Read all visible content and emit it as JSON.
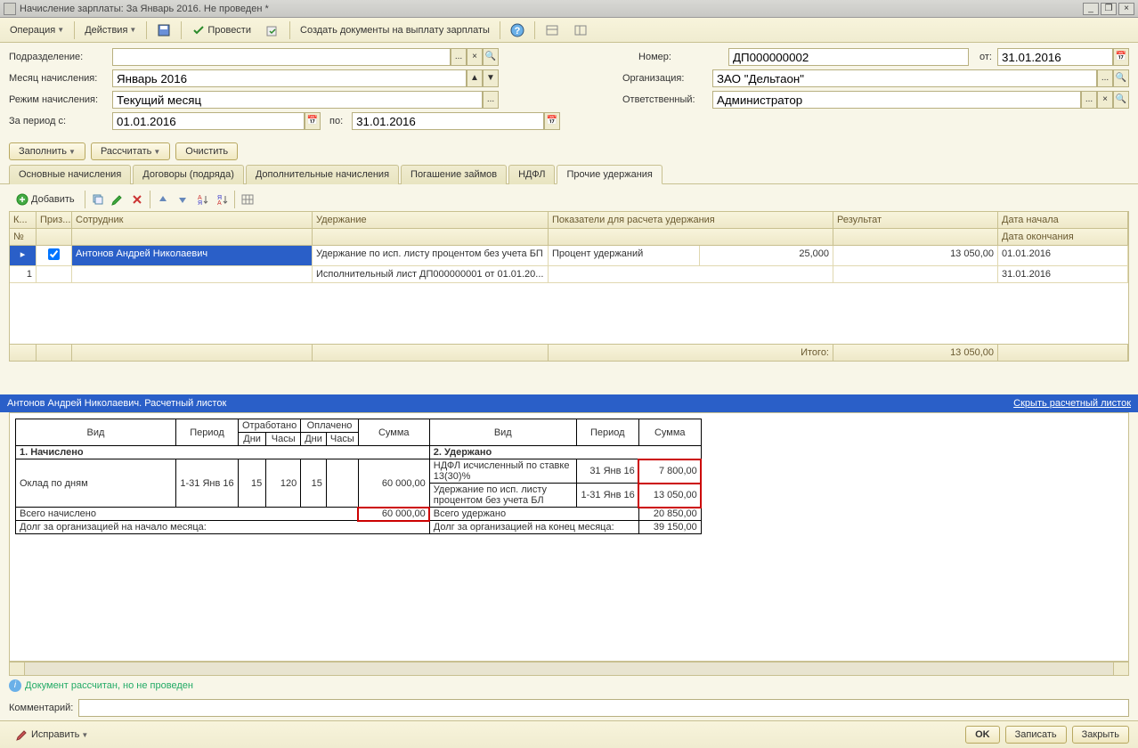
{
  "window": {
    "title": "Начисление зарплаты: За Январь 2016. Не проведен *"
  },
  "toolbar": {
    "operation": "Операция",
    "actions": "Действия",
    "post": "Провести",
    "create_docs": "Создать документы на выплату зарплаты"
  },
  "form": {
    "subdivision_label": "Подразделение:",
    "subdivision": "",
    "number_label": "Номер:",
    "number": "ДП000000002",
    "date_label": "от:",
    "date": "31.01.2016",
    "month_label": "Месяц начисления:",
    "month": "Январь 2016",
    "org_label": "Организация:",
    "org": "ЗАО \"Дельтаон\"",
    "mode_label": "Режим начисления:",
    "mode": "Текущий месяц",
    "resp_label": "Ответственный:",
    "resp": "Администратор",
    "period_from_label": "За период с:",
    "period_from": "01.01.2016",
    "period_to_label": "по:",
    "period_to": "31.01.2016"
  },
  "actions": {
    "fill": "Заполнить",
    "calc": "Рассчитать",
    "clear": "Очистить"
  },
  "tabs": [
    "Основные начисления",
    "Договоры (подряда)",
    "Дополнительные начисления",
    "Погашение займов",
    "НДФЛ",
    "Прочие удержания"
  ],
  "tabletb": {
    "add": "Добавить"
  },
  "grid": {
    "hdr": {
      "k": "К...",
      "priz": "Приз...",
      "emp": "Сотрудник",
      "ded": "Удержание",
      "ind": "Показатели для расчета удержания",
      "res": "Результат",
      "date1": "Дата начала",
      "n": "№",
      "date2": "Дата окончания"
    },
    "row": {
      "n": "1",
      "emp": "Антонов Андрей Николаевич",
      "ded1": "Удержание по исп. листу процентом без учета БП",
      "ded2": "Исполнительный лист ДП000000001 от 01.01.20...",
      "ind": "Процент удержаний",
      "indval": "25,000",
      "res": "13 050,00",
      "d1": "01.01.2016",
      "d2": "31.01.2016"
    },
    "footer": {
      "total_label": "Итого:",
      "total": "13 050,00"
    }
  },
  "payslip": {
    "title": "Антонов Андрей Николаевич. Расчетный листок",
    "hide": "Скрыть расчетный листок",
    "hdr": {
      "vid": "Вид",
      "period": "Период",
      "worked": "Отработано",
      "paid": "Оплачено",
      "days": "Дни",
      "hours": "Часы",
      "sum": "Сумма"
    },
    "sec1": "1. Начислено",
    "sec2": "2. Удержано",
    "r1": {
      "vid": "Оклад по дням",
      "period": "1-31 Янв 16",
      "wd": "15",
      "wh": "120",
      "pd": "15",
      "ph": "",
      "sum": "60 000,00"
    },
    "r2": {
      "vid": "НДФЛ исчисленный по ставке 13(30)%",
      "period": "31 Янв 16",
      "sum": "7 800,00"
    },
    "r3": {
      "vid": "Удержание по исп. листу процентом без учета БЛ",
      "period": "1-31 Янв 16",
      "sum": "13 050,00"
    },
    "tot1": {
      "label": "Всего начислено",
      "sum": "60 000,00"
    },
    "tot2": {
      "label": "Всего удержано",
      "sum": "20 850,00"
    },
    "debt1": "Долг за организацией на начало месяца:",
    "debt2": {
      "label": "Долг за организацией на конец месяца:",
      "sum": "39 150,00"
    }
  },
  "status": "Документ рассчитан, но не проведен",
  "comment_label": "Комментарий:",
  "bottom": {
    "fix": "Исправить",
    "ok": "OK",
    "save": "Записать",
    "close": "Закрыть"
  }
}
